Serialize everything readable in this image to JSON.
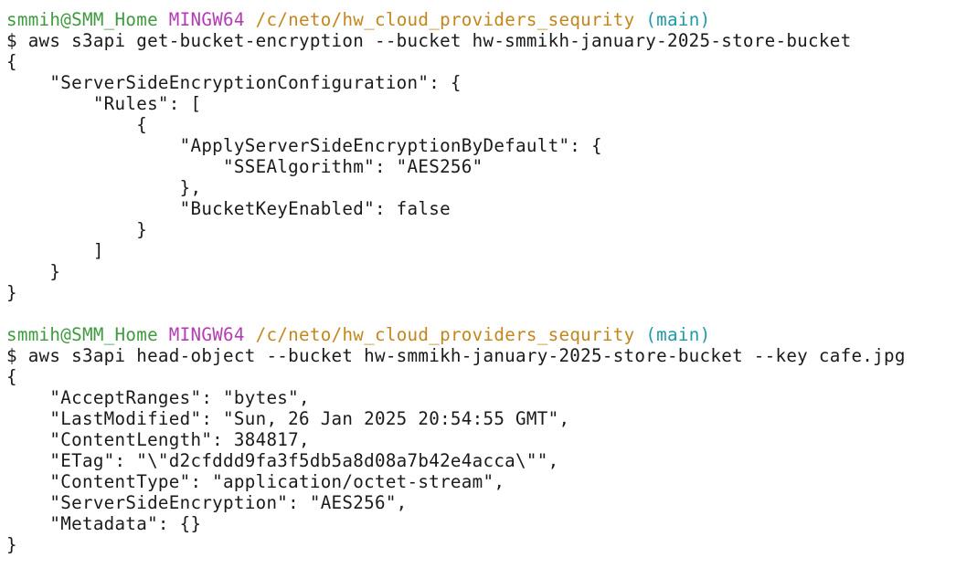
{
  "colors": {
    "background": "#ffffff",
    "text": "#1a1a1a",
    "user": "#3f9a3f",
    "host": "#b33bb3",
    "path": "#c4861c",
    "branch": "#1e9aa8"
  },
  "sessions": [
    {
      "prompt": {
        "user": "smmih@SMM_Home",
        "host": "MINGW64",
        "path": "/c/neto/hw_cloud_providers_sequrity",
        "branch": "(main)"
      },
      "command": "$ aws s3api get-bucket-encryption --bucket hw-smmikh-january-2025-store-bucket",
      "output": [
        "{",
        "    \"ServerSideEncryptionConfiguration\": {",
        "        \"Rules\": [",
        "            {",
        "                \"ApplyServerSideEncryptionByDefault\": {",
        "                    \"SSEAlgorithm\": \"AES256\"",
        "                },",
        "                \"BucketKeyEnabled\": false",
        "            }",
        "        ]",
        "    }",
        "}"
      ]
    },
    {
      "prompt": {
        "user": "smmih@SMM_Home",
        "host": "MINGW64",
        "path": "/c/neto/hw_cloud_providers_sequrity",
        "branch": "(main)"
      },
      "command": "$ aws s3api head-object --bucket hw-smmikh-january-2025-store-bucket --key cafe.jpg",
      "output": [
        "{",
        "    \"AcceptRanges\": \"bytes\",",
        "    \"LastModified\": \"Sun, 26 Jan 2025 20:54:55 GMT\",",
        "    \"ContentLength\": 384817,",
        "    \"ETag\": \"\\\"d2cfddd9fa3f5db5a8d08a7b42e4acca\\\"\",",
        "    \"ContentType\": \"application/octet-stream\",",
        "    \"ServerSideEncryption\": \"AES256\",",
        "    \"Metadata\": {}",
        "}"
      ]
    }
  ]
}
